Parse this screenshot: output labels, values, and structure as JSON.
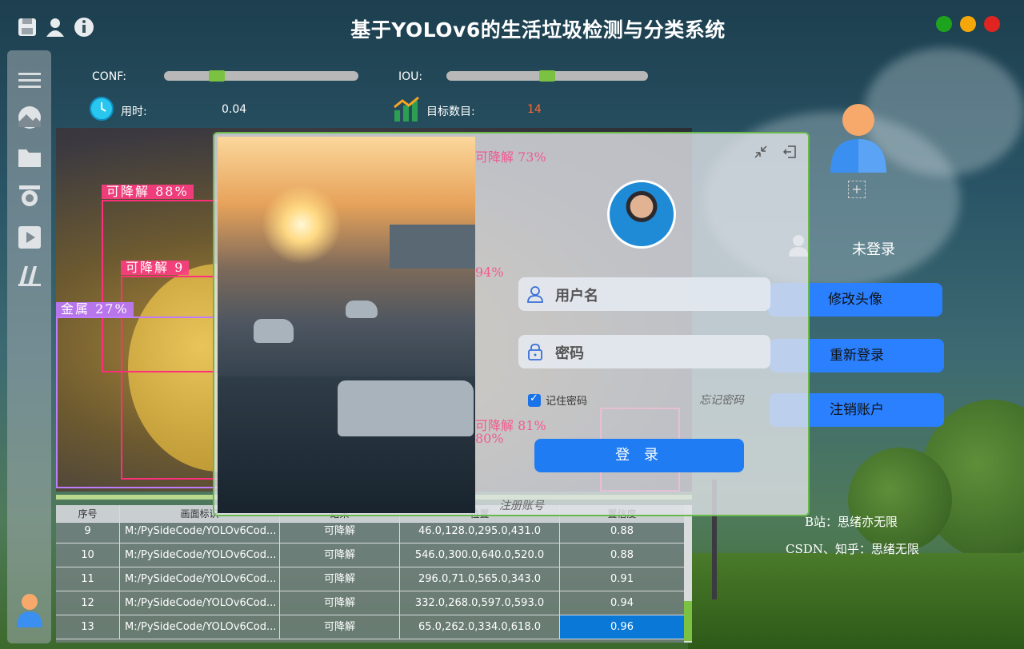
{
  "app": {
    "title": "基于YOLOv6的生活垃圾检测与分类系统"
  },
  "window_controls": {
    "maximize_color": "#1ea31e",
    "minimize_color": "#f5a70a",
    "close_color": "#e0241f"
  },
  "toolbar_icons": [
    "save-icon",
    "user-icon",
    "info-icon"
  ],
  "sidebar_icons": [
    "menu-icon",
    "image-icon",
    "folder-icon",
    "camera-icon",
    "play-icon",
    "model-icon",
    "user-avatar-icon"
  ],
  "controls": {
    "conf_label": "CONF:",
    "conf_value": 0.25,
    "iou_label": "IOU:",
    "iou_value": 0.5,
    "time_label": "用时:",
    "time_value": "0.04",
    "count_label": "目标数目:",
    "count_value": "14"
  },
  "detections": [
    {
      "label": "可降解 88%"
    },
    {
      "label": "可降解 9"
    },
    {
      "label": "金属 27%"
    },
    {
      "label": "可降解 73%"
    },
    {
      "label": "94%"
    },
    {
      "label": "可降解 8"
    },
    {
      "label": "可降解 81%"
    },
    {
      "label": "80%"
    },
    {
      "label": "可降"
    },
    {
      "label": "可降"
    },
    {
      "label": "可降"
    }
  ],
  "table": {
    "headers": [
      "序号",
      "画面标识",
      "结果",
      "位置",
      "置信度"
    ],
    "rows": [
      {
        "id": "9",
        "path": "M:/PySideCode/YOLOv6Cod...",
        "result": "可降解",
        "pos": "46.0,128.0,295.0,431.0",
        "conf": "0.88"
      },
      {
        "id": "10",
        "path": "M:/PySideCode/YOLOv6Cod...",
        "result": "可降解",
        "pos": "546.0,300.0,640.0,520.0",
        "conf": "0.88"
      },
      {
        "id": "11",
        "path": "M:/PySideCode/YOLOv6Cod...",
        "result": "可降解",
        "pos": "296.0,71.0,565.0,343.0",
        "conf": "0.91"
      },
      {
        "id": "12",
        "path": "M:/PySideCode/YOLOv6Cod...",
        "result": "可降解",
        "pos": "332.0,268.0,597.0,593.0",
        "conf": "0.94"
      },
      {
        "id": "13",
        "path": "M:/PySideCode/YOLOv6Cod...",
        "result": "可降解",
        "pos": "65.0,262.0,334.0,618.0",
        "conf": "0.96"
      }
    ]
  },
  "right_panel": {
    "status": "未登录",
    "btn_change_avatar": "修改头像",
    "btn_relogin": "重新登录",
    "btn_logout": "注销账户",
    "credit_bilibili": "B站：思绪亦无限",
    "credit_csdn": "CSDN、知乎：思绪无限"
  },
  "login": {
    "username_placeholder": "用户名",
    "password_placeholder": "密码",
    "remember_label": "记住密码",
    "forgot_label": "忘记密码",
    "login_button": "登 录",
    "register_label": "注册账号"
  }
}
